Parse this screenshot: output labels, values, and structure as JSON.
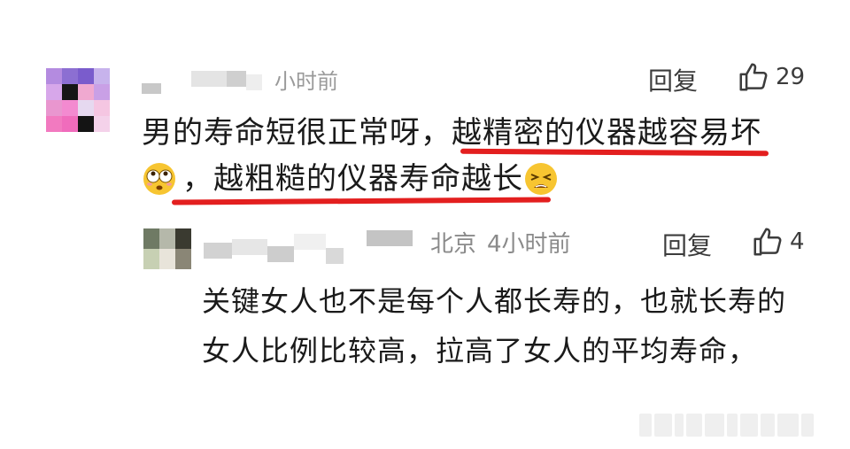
{
  "comment": {
    "time_fragment": "小时前",
    "reply_label": "回复",
    "like_count": "29",
    "text_part1": "男的寿命短很正常呀，",
    "text_part2": "越精密的仪器越容易坏",
    "text_part3": "，",
    "text_part4": "越粗糙的仪器寿命越长",
    "emoji1": "dizzy-eyes-emoji",
    "emoji2": "tired-face-emoji"
  },
  "reply": {
    "location": "北京",
    "time": "4小时前",
    "reply_label": "回复",
    "like_count": "4",
    "text": "关键女人也不是每个人都长寿的，也就长寿的女人比例比较高，拉高了女人的平均寿命，"
  },
  "colors": {
    "underline": "#e31f1f",
    "meta_gray": "#9a9a9a"
  }
}
